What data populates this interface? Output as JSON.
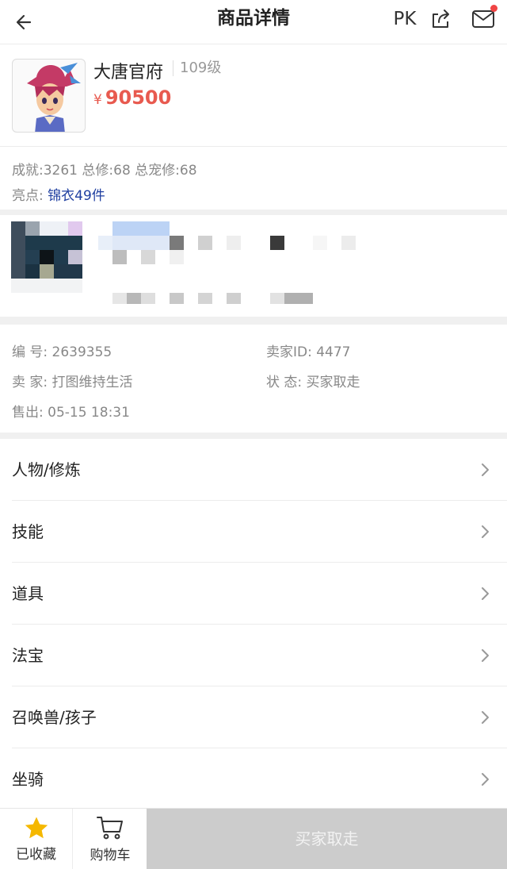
{
  "nav": {
    "title": "商品详情",
    "pk_label": "PK",
    "icons": [
      "back-arrow-icon",
      "share-icon",
      "mail-icon"
    ],
    "notification_dot_color": "#f04444"
  },
  "product": {
    "name": "大唐官府",
    "level": "109级",
    "currency": "¥",
    "price": "90500",
    "price_color": "#e85a4f"
  },
  "stats": {
    "line1": "成就:3261 总修:68 总宠修:68",
    "highlight_label": "亮点: ",
    "highlight_value": "锦衣49件",
    "highlight_color": "#1f3fa0"
  },
  "meta": {
    "id_label": "编  号: 2639355",
    "seller_id": "卖家ID: 4477",
    "seller": "卖  家: 打图维持生活",
    "status": "状  态: 买家取走",
    "sold": "售出: 05-15 18:31"
  },
  "menu": [
    {
      "label": "人物/修炼"
    },
    {
      "label": "技能"
    },
    {
      "label": "道具"
    },
    {
      "label": "法宝"
    },
    {
      "label": "召唤兽/孩子"
    },
    {
      "label": "坐骑"
    }
  ],
  "bottom": {
    "fav_label": "已收藏",
    "cart_label": "购物车",
    "main_label": "买家取走",
    "star_color": "#f5b800",
    "main_bg": "#cccccc"
  }
}
